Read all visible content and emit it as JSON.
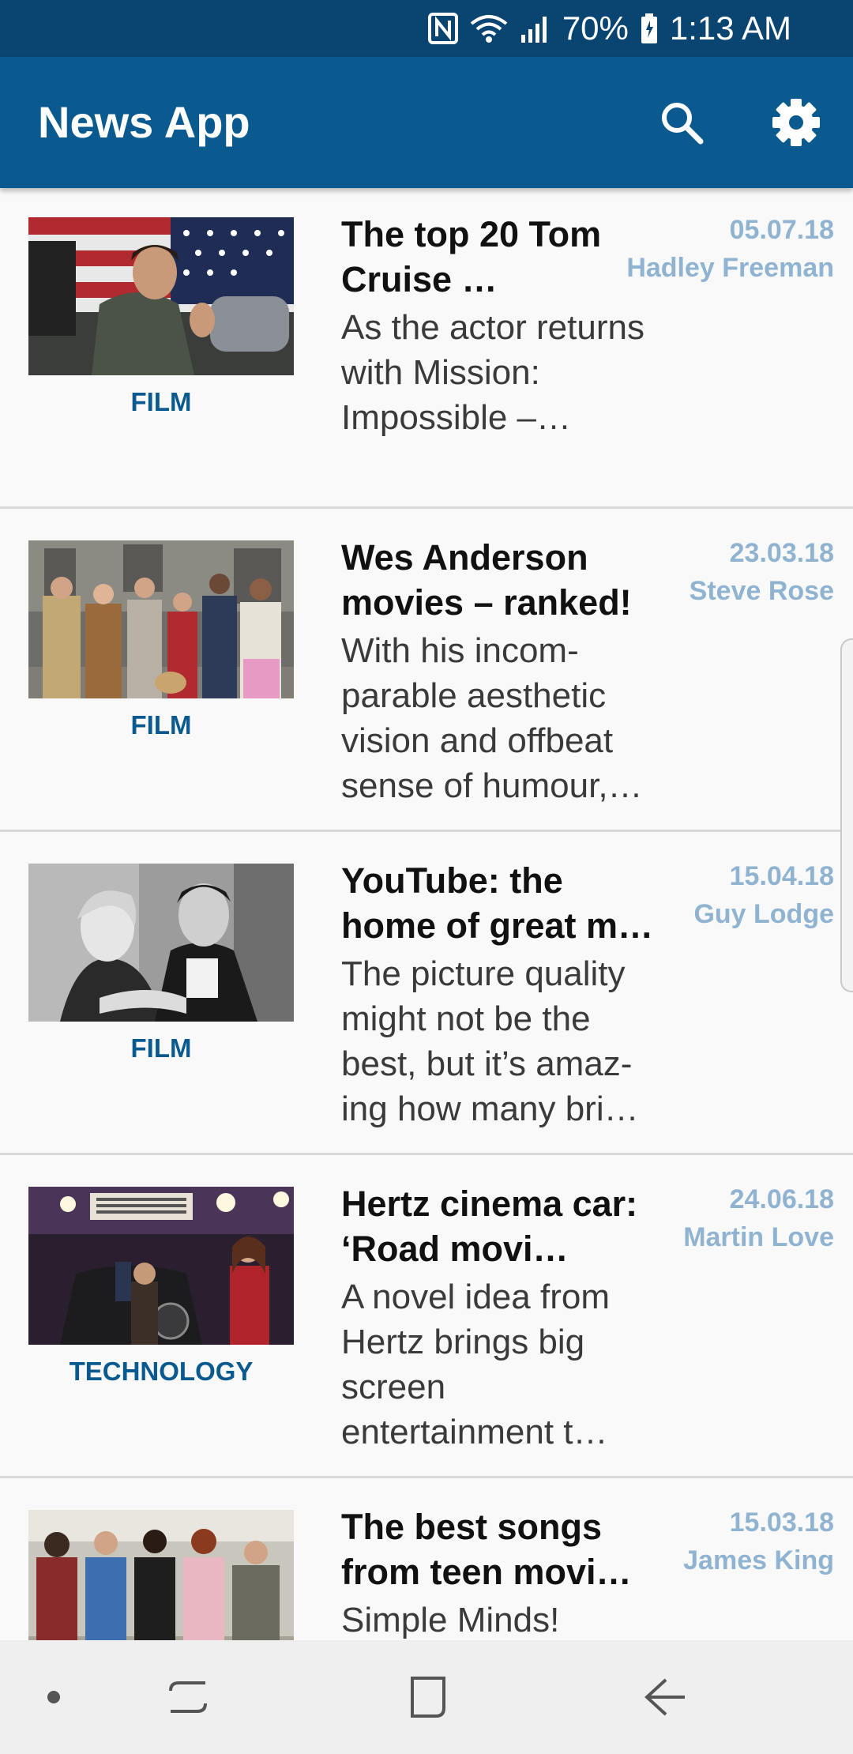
{
  "status_bar": {
    "battery": "70%",
    "time": "1:13 AM",
    "icons": [
      "nfc-icon",
      "wifi-icon",
      "signal-icon",
      "battery-icon"
    ]
  },
  "app_bar": {
    "title": "News App",
    "actions": [
      "search-icon",
      "settings-icon"
    ]
  },
  "articles": [
    {
      "category": "FILM",
      "headline": "The top 20 Tom Cruise …",
      "summary": "As the actor returns with Mission: Impossible –…",
      "date": "05.07.18",
      "author": "Hadley Freeman"
    },
    {
      "category": "FILM",
      "headline": "Wes Anderson movies – ranked!",
      "summary": "With his incom-parable aesthetic vision and offbeat sense of humour,…",
      "date": "23.03.18",
      "author": "Steve Rose"
    },
    {
      "category": "FILM",
      "headline": "YouTube: the home of great m…",
      "summary": "The picture quality might not be the best, but it’s amaz-ing how many bri…",
      "date": "15.04.18",
      "author": "Guy Lodge"
    },
    {
      "category": "TECHNOLOGY",
      "headline": "Hertz cinema car: ‘Road movi…",
      "summary": "A novel idea from Hertz brings big screen entertainment t…",
      "date": "24.06.18",
      "author": "Martin Love"
    },
    {
      "category": "",
      "headline": "The best songs from teen movi…",
      "summary": "Simple Minds!",
      "date": "15.03.18",
      "author": "James King"
    }
  ],
  "nav_bar": {
    "items": [
      "dot-icon",
      "recent-apps-icon",
      "home-icon",
      "back-icon"
    ]
  },
  "colors": {
    "status_bar": "#0a4470",
    "app_bar": "#0b5a8f",
    "category": "#0b5a8f",
    "meta": "#8fb3d0",
    "background": "#f9f9f9"
  }
}
